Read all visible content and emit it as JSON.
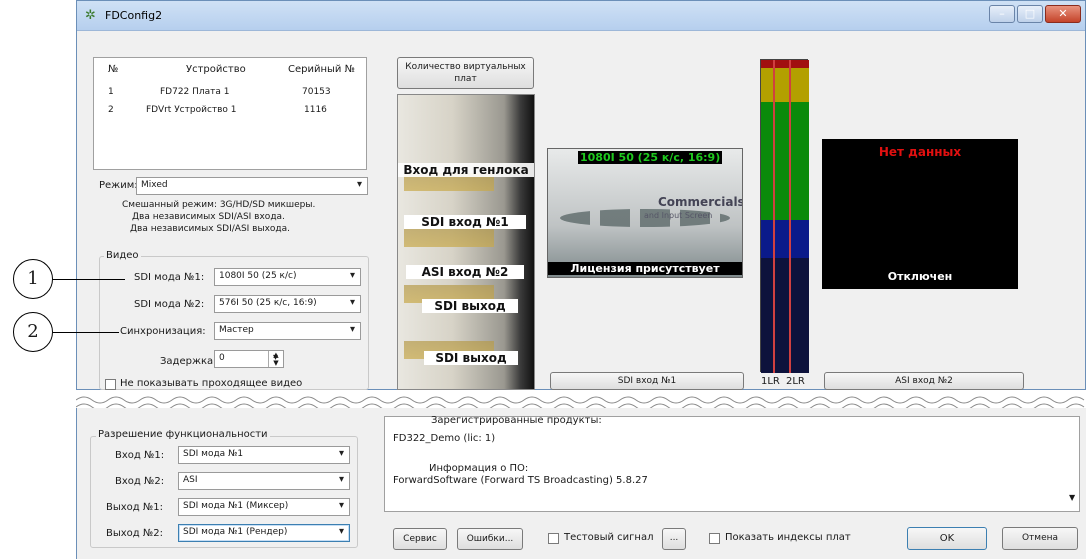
{
  "window": {
    "title": "FDConfig2",
    "minimize": "–",
    "maximize": "□",
    "close": "✕"
  },
  "device_table": {
    "headers": [
      "№",
      "Устройство",
      "Серийный №"
    ],
    "rows": [
      [
        "1",
        "FD722 Плата 1",
        "70153"
      ],
      [
        "2",
        "FDVrt Устройство 1",
        "1116"
      ]
    ]
  },
  "mode": {
    "label": "Режим:",
    "value": "Mixed",
    "description": [
      "Смешанный режим: 3G/HD/SD микшеры.",
      "Два независимых SDI/ASI входа.",
      "Два независимых SDI/ASI выхода."
    ]
  },
  "video": {
    "group_label": "Видео",
    "sdi_mode1_label": "SDI мода №1:",
    "sdi_mode1_value": "1080I 50 (25 к/с)",
    "sdi_mode2_label": "SDI мода №2:",
    "sdi_mode2_value": "576I 50 (25 к/с, 16:9)",
    "sync_label": "Синхронизация:",
    "sync_value": "Мастер",
    "delay_label": "Задержка:",
    "delay_value": "0",
    "hide_video_label": "Не показывать проходящее видео"
  },
  "callouts": {
    "one": "1",
    "two": "2"
  },
  "virtual_boards_button": "Количество виртуальных плат",
  "board_labels": [
    "Вход для генлока",
    "SDI вход №1",
    "ASI вход №2",
    "SDI выход",
    "SDI выход"
  ],
  "preview1": {
    "format": "1080I 50 (25 к/с, 16:9)",
    "logo_line1": "Commercials",
    "logo_line2": "and Input Screen",
    "license": "Лицензия присутствует",
    "button": "SDI вход №1"
  },
  "meter": {
    "labels": [
      "1LR",
      "2LR"
    ],
    "levels": [
      0.97,
      0.97
    ]
  },
  "preview2": {
    "status": "Нет данных",
    "state": "Отключен",
    "button": "ASI вход №2"
  },
  "functionality": {
    "group_label": "Разрешение функциональности",
    "rows": [
      {
        "label": "Вход №1:",
        "value": "SDI мода №1"
      },
      {
        "label": "Вход №2:",
        "value": "ASI"
      },
      {
        "label": "Выход №1:",
        "value": "SDI мода №1 (Миксер)"
      },
      {
        "label": "Выход №2:",
        "value": "SDI мода №1 (Рендер)"
      }
    ]
  },
  "info": {
    "registered_header": "Зарегистрированные продукты:",
    "product": "FD322_Demo (lic: 1)",
    "sw_header": "Информация о ПО:",
    "sw": "ForwardSoftware (Forward TS Broadcasting) 5.8.27"
  },
  "bottom": {
    "service": "Сервис",
    "errors": "Ошибки...",
    "test_signal": "Тестовый сигнал",
    "ellipsis": "...",
    "show_indexes": "Показать индексы плат",
    "ok": "OK",
    "cancel": "Отмена"
  },
  "colors": {
    "accent": "#3b7a2e",
    "meter_red": "#a11010",
    "meter_yellow": "#b3a000",
    "meter_green": "#0a8a0a",
    "meter_blue": "#0a1a8a"
  }
}
